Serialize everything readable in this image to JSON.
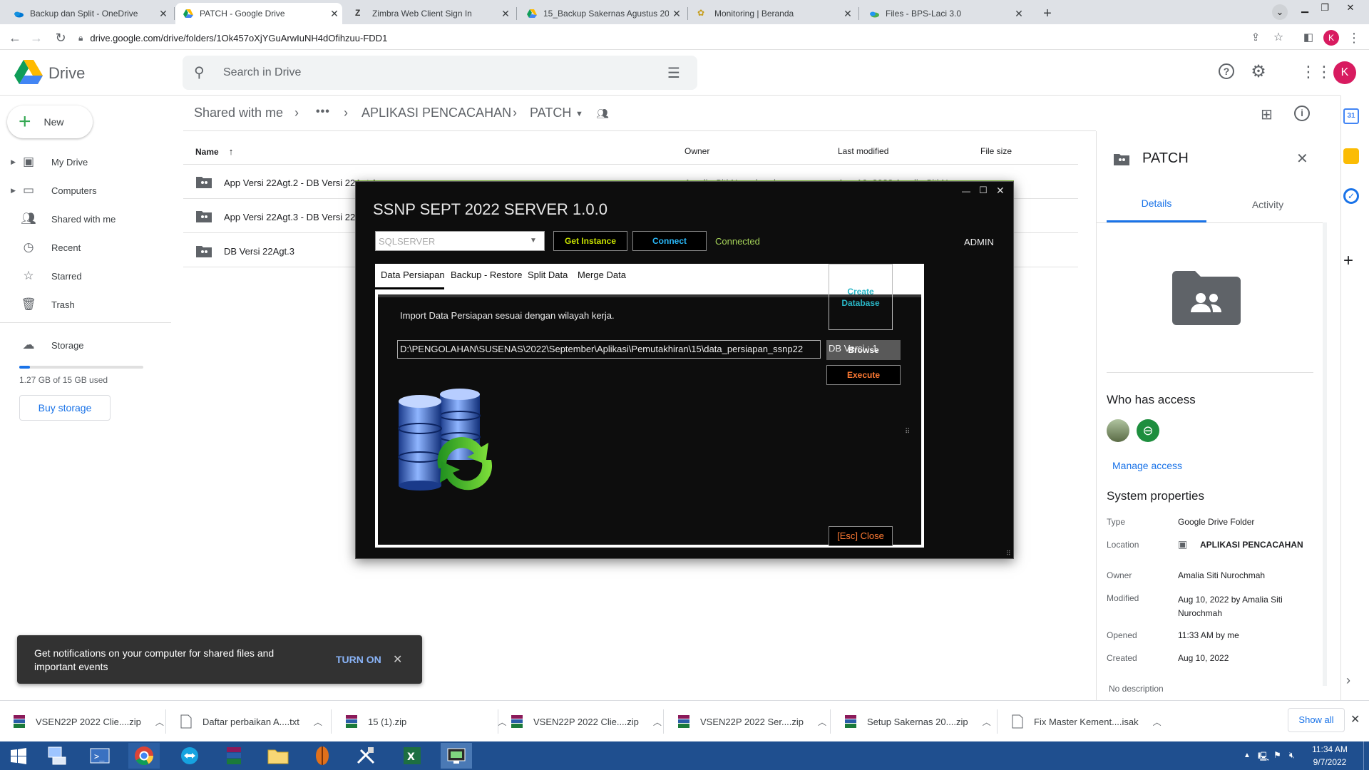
{
  "browser": {
    "tabs": [
      {
        "title": "Backup dan Split - OneDrive",
        "active": false
      },
      {
        "title": "PATCH - Google Drive",
        "active": true
      },
      {
        "title": "Zimbra Web Client Sign In",
        "active": false
      },
      {
        "title": "15_Backup Sakernas Agustus 202",
        "active": false
      },
      {
        "title": "Monitoring | Beranda",
        "active": false
      },
      {
        "title": "Files - BPS-Laci 3.0",
        "active": false
      }
    ],
    "url": "drive.google.com/drive/folders/1Ok457oXjYGuArwIuNH4dOfihzuu-FDD1",
    "profile_initial": "K"
  },
  "drive": {
    "app_name": "Drive",
    "search_placeholder": "Search in Drive",
    "user_initial": "K",
    "new_label": "New",
    "nav": [
      {
        "label": "My Drive",
        "icon": "my-drive-icon"
      },
      {
        "label": "Computers",
        "icon": "computer-icon"
      },
      {
        "label": "Shared with me",
        "icon": "people-icon"
      },
      {
        "label": "Recent",
        "icon": "clock-icon"
      },
      {
        "label": "Starred",
        "icon": "star-icon"
      },
      {
        "label": "Trash",
        "icon": "trash-icon"
      }
    ],
    "storage": {
      "label": "Storage",
      "used_text": "1.27 GB of 15 GB used",
      "fraction": 0.085,
      "buy_label": "Buy storage"
    },
    "breadcrumb": [
      "Shared with me",
      "•••",
      "APLIKASI PENCACAHAN",
      "PATCH"
    ],
    "columns": {
      "name": "Name",
      "owner": "Owner",
      "modified": "Last modified",
      "size": "File size"
    },
    "files": [
      {
        "name": "App Versi 22Agt.2 - DB Versi 22Agt.1",
        "owner": "Amalia Siti Nurochmah",
        "modified": "Aug 16, 2022 Amalia Siti Nuro"
      },
      {
        "name": "App Versi 22Agt.3 - DB Versi 22Agt.3",
        "owner": "",
        "modified": ""
      },
      {
        "name": "DB Versi 22Agt.3",
        "owner": "",
        "modified": ""
      }
    ]
  },
  "details": {
    "title": "PATCH",
    "tabs": [
      "Details",
      "Activity"
    ],
    "who_has_access": "Who has access",
    "manage_access": "Manage access",
    "system_properties": "System properties",
    "props": [
      {
        "label": "Type",
        "value": "Google Drive Folder"
      },
      {
        "label": "Location",
        "value": "APLIKASI PENCACAHAN"
      },
      {
        "label": "Owner",
        "value": "Amalia Siti Nurochmah"
      },
      {
        "label": "Modified",
        "value": "Aug 10, 2022 by Amalia Siti Nurochmah"
      },
      {
        "label": "Opened",
        "value": "11:33 AM by me"
      },
      {
        "label": "Created",
        "value": "Aug 10, 2022"
      }
    ],
    "no_description": "No description"
  },
  "app": {
    "title": "SSNP SEPT 2022 SERVER 1.0.0",
    "server_value": "SQLSERVER",
    "get_instance": "Get Instance",
    "connect": "Connect",
    "status": "Connected",
    "user": "ADMIN",
    "tabs": [
      "Data Persiapan",
      "Backup - Restore",
      "Split Data",
      "Merge Data"
    ],
    "instruction": "Import Data Persiapan sesuai dengan wilayah kerja.",
    "path": "D:\\PENGOLAHAN\\SUSENAS\\2022\\September\\Aplikasi\\Pemutakhiran\\15\\data_persiapan_ssnp22",
    "browse": "Browse",
    "execute": "Execute",
    "create_database": "Create Database",
    "db_version": "DB Versi : 1",
    "close": "[Esc] Close"
  },
  "notification": {
    "text": "Get notifications on your computer for shared files and important events",
    "action": "TURN ON"
  },
  "downloads": {
    "items": [
      "VSEN22P 2022 Clie....zip",
      "Daftar perbaikan A....txt",
      "15 (1).zip",
      "VSEN22P 2022 Clie....zip",
      "VSEN22P 2022 Ser....zip",
      "Setup Sakernas 20....zip",
      "Fix Master Kement....isak"
    ],
    "show_all": "Show all"
  },
  "taskbar": {
    "time": "11:34 AM",
    "date": "9/7/2022"
  }
}
